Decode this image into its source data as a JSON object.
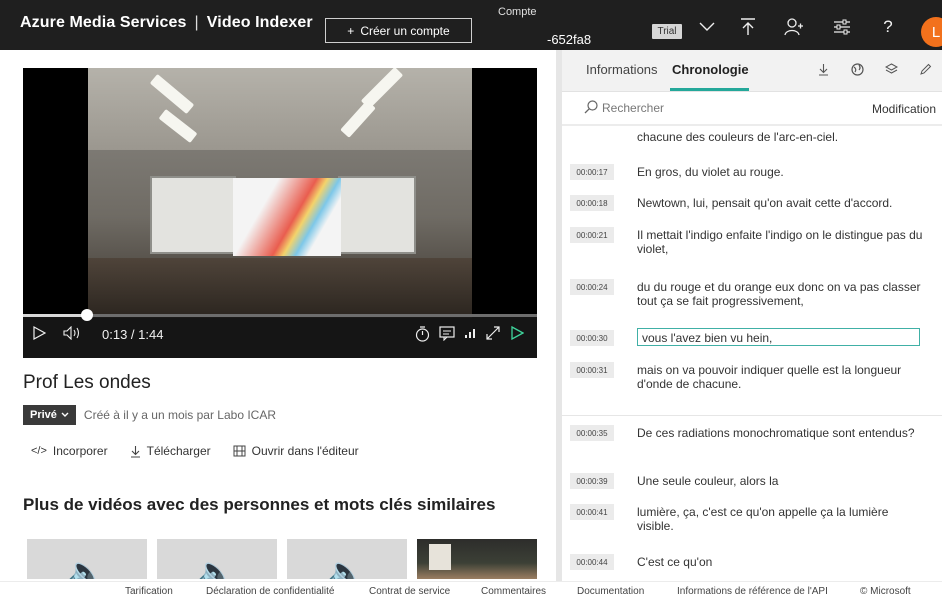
{
  "header": {
    "brand": "Azure Media Services",
    "product": "Video Indexer",
    "create_account": "Créer un compte",
    "account_label": "Compte",
    "account_id": "-652fa8",
    "trial_badge": "Trial",
    "avatar_initial": "L"
  },
  "player": {
    "time_current": "0:13",
    "time_total": "1:44",
    "progress": 0.125
  },
  "video": {
    "title": "Prof Les ondes",
    "privacy": "Privé",
    "meta": "Créé à il y a un mois par Labo ICAR",
    "actions": {
      "embed": "Incorporer",
      "download": "Télécharger",
      "open_editor": "Ouvrir dans l'éditeur"
    },
    "related_heading": "Plus de vidéos avec des personnes et mots clés similaires"
  },
  "panel": {
    "tabs": {
      "info": "Informations",
      "timeline": "Chronologie"
    },
    "search_placeholder": "Rechercher",
    "edit_label": "Modification",
    "transcript": [
      {
        "time": "",
        "text": "chacune des couleurs de l'arc-en-ciel."
      },
      {
        "time": "00:00:17",
        "text": "En gros, du violet au rouge."
      },
      {
        "time": "00:00:18",
        "text": "Newtown, lui, pensait qu'on avait cette d'accord."
      },
      {
        "time": "00:00:21",
        "text": "Il mettait l'indigo enfaite l'indigo on le distingue pas du violet,"
      },
      {
        "time": "00:00:24",
        "text": "du du rouge et du orange eux donc on va pas classer tout ça se fait progressivement,"
      },
      {
        "time": "00:00:30",
        "text": "vous l'avez bien vu hein,"
      },
      {
        "time": "00:00:31",
        "text": "mais on va pouvoir indiquer quelle est la longueur d'onde de chacune."
      },
      {
        "time": "00:00:35",
        "text": "De ces radiations monochromatique sont entendus?"
      },
      {
        "time": "00:00:39",
        "text": "Une seule couleur, alors la"
      },
      {
        "time": "00:00:41",
        "text": "lumière, ça, c'est ce qu'on appelle ça la lumière visible."
      },
      {
        "time": "00:00:44",
        "text": "C'est ce qu'on"
      }
    ]
  },
  "footer": {
    "links": [
      "Tarification",
      "Déclaration de confidentialité",
      "Contrat de service",
      "Commentaires",
      "Documentation",
      "Informations de référence de l'API",
      "© Microsoft"
    ]
  },
  "colors": {
    "topbar": "#1f1f1f",
    "accent": "#24a89a",
    "avatar": "#f2711c"
  }
}
